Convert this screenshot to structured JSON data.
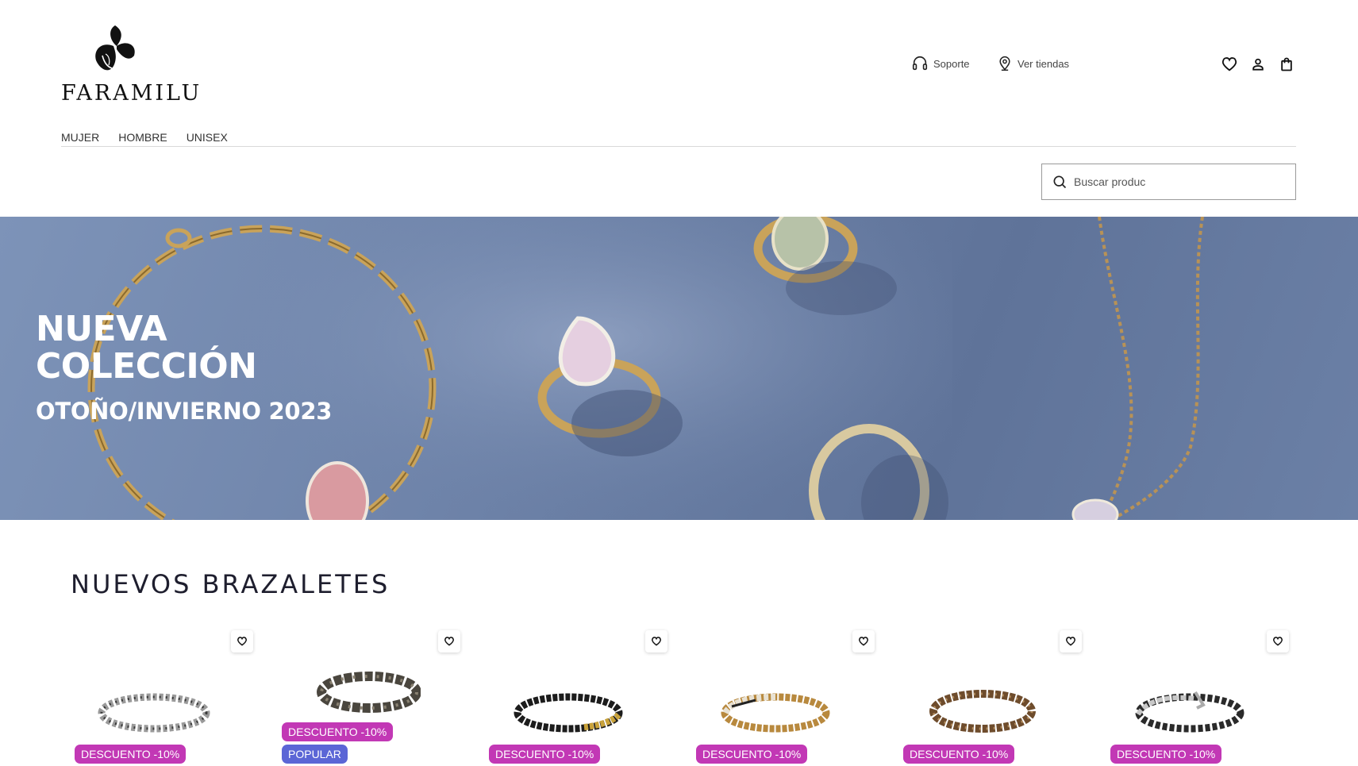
{
  "brand": {
    "name": "FARAMILU"
  },
  "header": {
    "utility_links": [
      {
        "label": "Soporte",
        "icon": "headset-icon"
      },
      {
        "label": "Ver tiendas",
        "icon": "map-pin-icon"
      }
    ],
    "icons": [
      "heart-icon",
      "user-icon",
      "shopping-bag-icon"
    ]
  },
  "nav": {
    "items": [
      "MUJER",
      "HOMBRE",
      "UNISEX"
    ]
  },
  "search": {
    "placeholder": "Buscar produc",
    "value": ""
  },
  "hero": {
    "title_line1": "NUEVA",
    "title_line2": "COLECCIÓN",
    "subtitle": "OTOÑO/INVIERNO 2023"
  },
  "products_section": {
    "title": "NUEVOS BRAZALETES",
    "products": [
      {
        "badges": [
          "DESCUENTO -10%"
        ]
      },
      {
        "badges": [
          "DESCUENTO -10%",
          "POPULAR"
        ]
      },
      {
        "badges": [
          "DESCUENTO -10%"
        ]
      },
      {
        "badges": [
          "DESCUENTO -10%"
        ]
      },
      {
        "badges": [
          "DESCUENTO -10%"
        ]
      },
      {
        "badges": [
          "DESCUENTO -10%"
        ]
      }
    ]
  },
  "colors": {
    "discount_badge": "#c238b5",
    "popular_badge": "#5b66d6",
    "hero_background": "#6f84aa",
    "title_text": "#1e1e2e"
  }
}
